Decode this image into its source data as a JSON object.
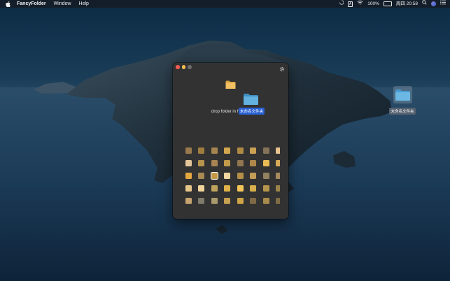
{
  "menubar": {
    "app_name": "FancyFolder",
    "items": [
      "Window",
      "Help"
    ],
    "status": {
      "input_method": "A",
      "battery": "100%",
      "clock": "周四 20:58"
    }
  },
  "window": {
    "drop_label": "drop folder in here",
    "dragged_folder_name": "未命名文件夹",
    "swatches": [
      [
        "#9a7a4c",
        "#a07d3e",
        "#a4854f",
        "#d4a64e",
        "#b08a45",
        "#caa053",
        "#857359",
        "#e8c48e"
      ],
      [
        "#e4c69a",
        "#b8944d",
        "#a78452",
        "#c29a4a",
        "#927650",
        "#b1884b",
        "#e8bb54",
        "#d8a958"
      ],
      [
        "#e5a840",
        "#a88a53",
        "#c59847",
        "#f0d6a0",
        "#b58f48",
        "#c39c56",
        "#93825f",
        "#a78a5f"
      ],
      [
        "#e6c58a",
        "#f0d49c",
        "#bfa25b",
        "#e1b14a",
        "#f3c657",
        "#d8af4c",
        "#b5944c",
        "#9a8248"
      ],
      [
        "#c6a36f",
        "#7f7a6a",
        "#aa9a6c",
        "#c7a150",
        "#cfa446",
        "#7f6a45",
        "#a98c4c",
        "#806c44"
      ],
      [
        "#e8c04e",
        "#d0a75a",
        "#c8a35c",
        "#b69954",
        "#caa650",
        "#c29d5d",
        "#b99855",
        "#d1b45c"
      ]
    ],
    "selected_swatch": "2-2"
  },
  "desktop": {
    "folder_label": "未命名文件夹"
  },
  "colors": {
    "window_bg": "#323232",
    "folder_blue": "#5aa8d8",
    "folder_yellow": "#f0c060",
    "selection_blue": "#2a62d4"
  }
}
